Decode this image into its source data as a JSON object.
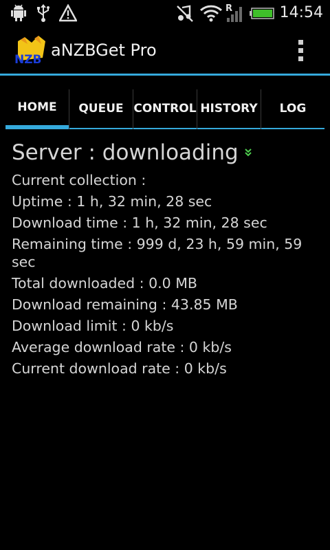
{
  "status_bar": {
    "time": "14:54",
    "icons": [
      "android-debug-icon",
      "usb-icon",
      "warning-icon",
      "mute-icon",
      "wifi-icon",
      "signal-roaming-icon",
      "battery-icon"
    ],
    "roaming_label": "R",
    "battery_level": 1.0,
    "battery_color": "#3fbf2a"
  },
  "app_bar": {
    "logo_text": "NZB",
    "title": "aNZBGet Pro",
    "accent_color": "#35aadc"
  },
  "tabs": [
    {
      "label": "HOME",
      "selected": true
    },
    {
      "label": "QUEUE",
      "selected": false
    },
    {
      "label": "CONTROL",
      "selected": false
    },
    {
      "label": "HISTORY",
      "selected": false
    },
    {
      "label": "LOG",
      "selected": false
    }
  ],
  "server": {
    "title": "Server : downloading",
    "status_icon": "chevron-double-down-icon",
    "status_color": "#4fd04f"
  },
  "info_lines": [
    "Current collection :",
    "Uptime : 1 h, 32 min, 28 sec",
    "Download time : 1 h, 32 min, 28 sec",
    "Remaining time : 999 d, 23 h, 59 min, 59 sec",
    "Total downloaded : 0.0 MB",
    "Download remaining : 43.85 MB",
    "Download limit : 0 kb/s",
    "Average download rate : 0 kb/s",
    "Current download rate : 0 kb/s"
  ]
}
